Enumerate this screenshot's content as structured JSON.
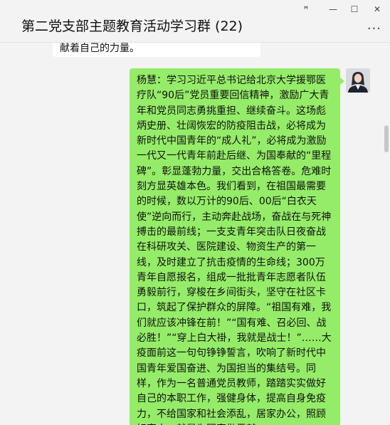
{
  "window": {
    "title": "第二党支部主题教育活动学习群 (22)",
    "controls": {
      "pin": "ꟸ",
      "minimize": "—",
      "maximize": "☐",
      "close": "✕"
    },
    "more": "···"
  },
  "chat": {
    "previous_message_tail": "献着自己的力量。",
    "message": {
      "text": "杨慧：学习习近平总书记给北京大学援鄂医疗队“90后”党员重要回信精神，激励广大青年和党员同志勇挑重担、继续奋斗。这场彪炳史册、壮阔恢宏的防疫阻击战，必将成为新时代中国青年的“成人礼”，必将成为激励一代又一代青年前赴后继、为国奉献的“里程碑”。彰显蓬勃力量，交出合格答卷。危难时刻方显英雄本色。我们看到，在祖国最需要的时候，数以万计的90后、00后“白衣天使”逆向而行，主动奔赴战场，奋战在与死神搏击的最前线；一支支青年突击队日夜奋战在科研攻关、医院建设、物资生产的第一线，及时建立了抗击疫情的生命线；300万青年自愿报名，组成一批批青年志愿者队伍勇毅前行，穿梭在乡间街头，坚守在社区卡口，筑起了保护群众的屏障。“祖国有难，我们就应该冲锋在前！”“国有难、召必回、战必胜！”“穿上白大褂，我就是战士！”……大疫面前这一句句铮铮誓言，吹响了新时代中国青年爱国奋进、为国担当的集结号。同样，作为一名普通党员教师，踏踏实实做好自己的本职工作，强健身体，提高自身免疫力，不给国家和社会添乱，居家办公，照顾好家人，就是为国家做贡献。"
    }
  },
  "colors": {
    "bubble_self": "#95ec69",
    "bubble_other": "#ffffff",
    "background": "#f3f3f3"
  }
}
